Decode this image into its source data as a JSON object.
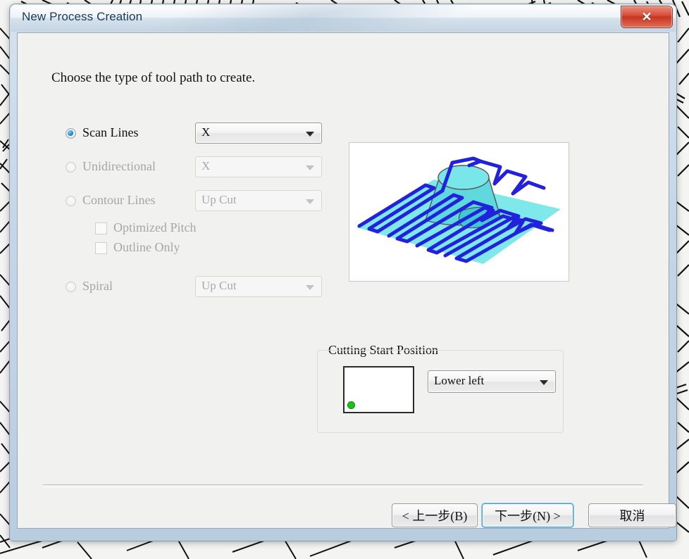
{
  "window": {
    "title": "New Process Creation",
    "close_label": "✕",
    "close_icon": "close-icon"
  },
  "dialog": {
    "heading": "Choose the type of tool path to create.",
    "options": [
      {
        "label": "Scan Lines",
        "enabled": true,
        "checked": true,
        "combo": {
          "value": "X",
          "enabled": true
        }
      },
      {
        "label": "Unidirectional",
        "enabled": false,
        "checked": false,
        "combo": {
          "value": "X",
          "enabled": false
        }
      },
      {
        "label": "Contour Lines",
        "enabled": false,
        "checked": false,
        "combo": {
          "value": "Up Cut",
          "enabled": false
        }
      },
      {
        "label": "Spiral",
        "enabled": false,
        "checked": false,
        "combo": {
          "value": "Up Cut",
          "enabled": false
        }
      }
    ],
    "checkboxes": [
      {
        "label": "Optimized Pitch",
        "checked": false,
        "enabled": false
      },
      {
        "label": "Outline Only",
        "checked": false,
        "enabled": false
      }
    ],
    "group": {
      "title": "Cutting Start Position",
      "selected": "Lower left",
      "marker_color": "#16c516"
    },
    "buttons": {
      "back": "< 上一步(B)",
      "next": "下一步(N) >",
      "cancel": "取消"
    }
  },
  "colors": {
    "accent": "#3c9ede",
    "surface_fill": "#7ee8ea",
    "toolpath_stroke": "#2222dd",
    "close_red": "#d9503c"
  }
}
